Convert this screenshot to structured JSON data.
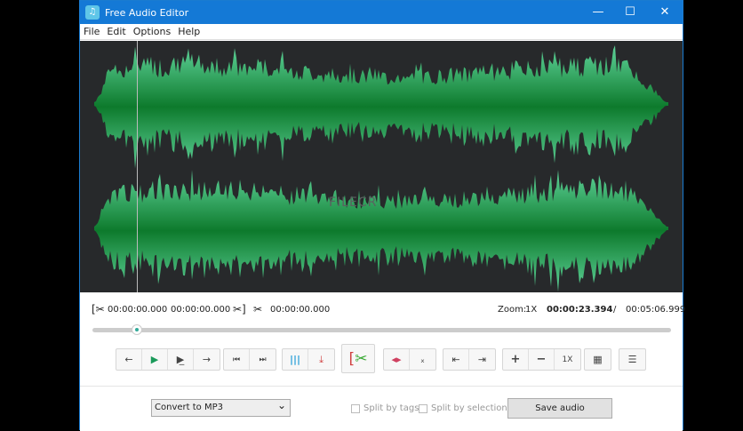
{
  "window": {
    "title": "Free Audio Editor",
    "minimize": "—",
    "maximize": "☐",
    "close": "✕"
  },
  "menu": [
    "File",
    "Edit",
    "Options",
    "Help"
  ],
  "watermark": "FILECR",
  "times": {
    "sel_start": "00:00:00.000",
    "sel_end": "00:00:00.000",
    "cut": "00:00:00.000",
    "zoom_label": "Zoom:",
    "zoom": "1X",
    "current": "00:00:23.394",
    "sep": "/",
    "total": "00:05:06.999"
  },
  "playback_position": 0.076,
  "toolbar": {
    "zoom_reset": "1X"
  },
  "bottom": {
    "format": "Convert to MP3",
    "split_tags": "Split by tags",
    "split_sel": "Split by selections",
    "save": "Save audio"
  },
  "colors": {
    "title": "#1479d6",
    "wave": "#3cb878",
    "wave_dark": "#0f7a30"
  }
}
